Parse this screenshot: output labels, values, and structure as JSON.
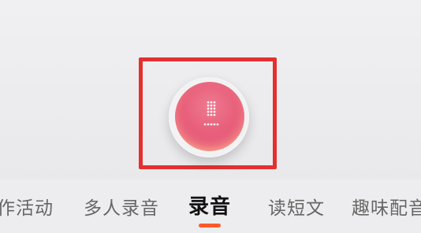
{
  "tabs": [
    {
      "label": "作活动",
      "active": false
    },
    {
      "label": "多人录音",
      "active": false
    },
    {
      "label": "录音",
      "active": true
    },
    {
      "label": "读短文",
      "active": false
    },
    {
      "label": "趣味配音",
      "active": false
    }
  ],
  "record_button": {
    "icon": "microphone-icon"
  },
  "colors": {
    "accent": "#ff5a2b",
    "highlight_box": "#e3302f",
    "record_pink": "#e8607c"
  }
}
